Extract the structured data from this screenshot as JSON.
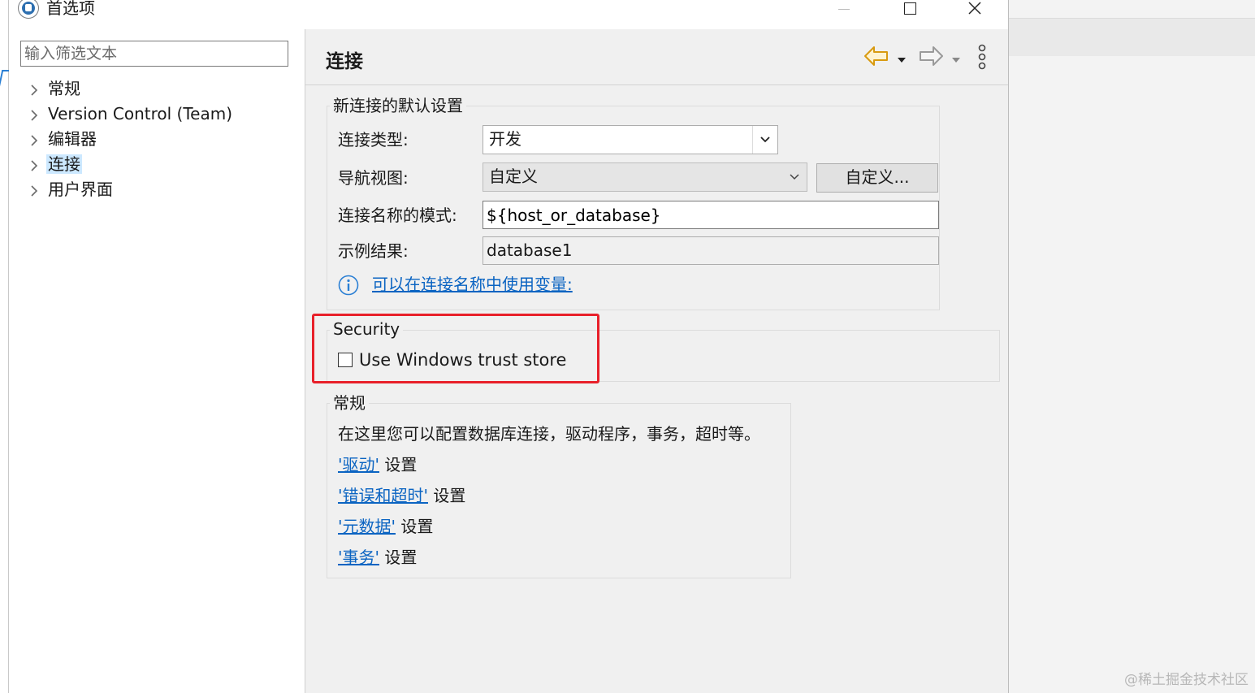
{
  "window": {
    "title": "首选项"
  },
  "filter": {
    "placeholder": "输入筛选文本"
  },
  "tree": {
    "items": [
      {
        "label": "常规"
      },
      {
        "label": "Version Control (Team)"
      },
      {
        "label": "编辑器"
      },
      {
        "label": "连接",
        "selected": true
      },
      {
        "label": "用户界面"
      }
    ]
  },
  "page": {
    "title": "连接"
  },
  "defaults_group": {
    "title": "新连接的默认设置",
    "connection_type_label": "连接类型:",
    "connection_type_value": "开发",
    "nav_view_label": "导航视图:",
    "nav_view_value": "自定义",
    "customize_button": "自定义...",
    "name_pattern_label": "连接名称的模式:",
    "name_pattern_value": "${host_or_database}",
    "sample_label": "示例结果:",
    "sample_value": "database1",
    "variables_link": "可以在连接名称中使用变量:"
  },
  "security_group": {
    "title": "Security",
    "trust_store_label": "Use Windows trust store",
    "trust_store_checked": false
  },
  "general_group": {
    "title": "常规",
    "description": "在这里您可以配置数据库连接，驱动程序，事务，超时等。",
    "links": [
      {
        "link": "'驱动'",
        "suffix": " 设置"
      },
      {
        "link": "'错误和超时'",
        "suffix": " 设置"
      },
      {
        "link": "'元数据'",
        "suffix": " 设置"
      },
      {
        "link": "'事务'",
        "suffix": " 设置"
      }
    ]
  },
  "watermark": "@稀土掘金技术社区",
  "colors": {
    "link": "#0b64c2",
    "selection": "#cce8ff",
    "highlight_border": "#e8202a",
    "nav_back_arrow": "#e8a317"
  }
}
